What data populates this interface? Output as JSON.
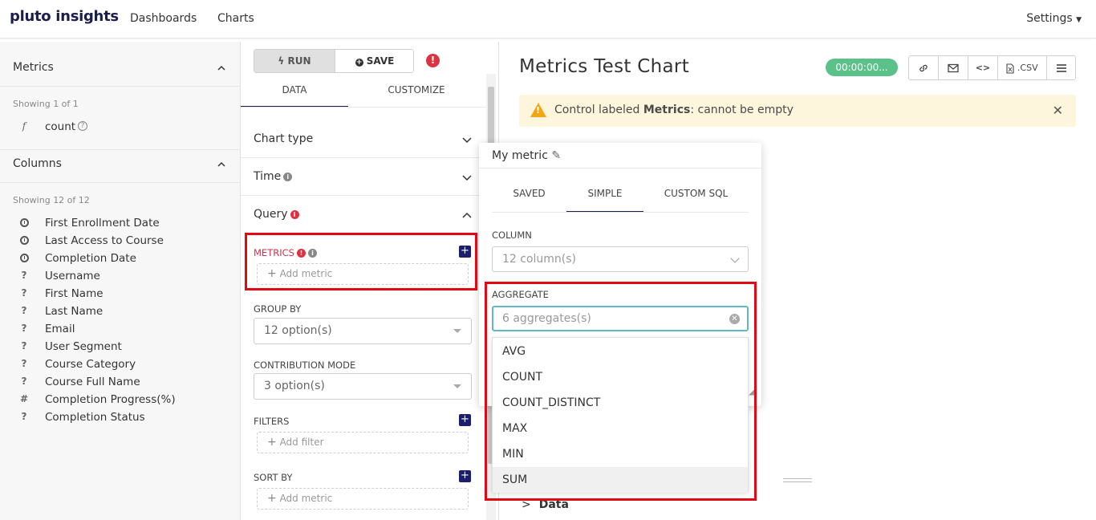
{
  "nav": {
    "logo": "pluto insights",
    "links": [
      "Dashboards",
      "Charts"
    ],
    "settings": "Settings"
  },
  "datasource": {
    "metrics_header": "Metrics",
    "metrics_showing": "Showing 1 of 1",
    "metrics": [
      {
        "type": "f",
        "label": "count"
      }
    ],
    "columns_header": "Columns",
    "columns_showing": "Showing 12 of 12",
    "columns": [
      {
        "type": "clock",
        "label": "First Enrollment Date"
      },
      {
        "type": "clock",
        "label": "Last Access to Course"
      },
      {
        "type": "clock",
        "label": "Completion Date"
      },
      {
        "type": "?",
        "label": "Username"
      },
      {
        "type": "?",
        "label": "First Name"
      },
      {
        "type": "?",
        "label": "Last Name"
      },
      {
        "type": "?",
        "label": "Email"
      },
      {
        "type": "?",
        "label": "User Segment"
      },
      {
        "type": "?",
        "label": "Course Category"
      },
      {
        "type": "?",
        "label": "Course Full Name"
      },
      {
        "type": "#",
        "label": "Completion Progress(%)"
      },
      {
        "type": "?",
        "label": "Completion Status"
      }
    ]
  },
  "controls": {
    "run_label": "RUN",
    "save_label": "SAVE",
    "tabs": [
      "DATA",
      "CUSTOMIZE"
    ],
    "chart_type": "Chart type",
    "time": "Time",
    "query": "Query",
    "metrics_label": "METRICS",
    "add_metric": "Add metric",
    "group_by_label": "GROUP BY",
    "group_by_value": "12 option(s)",
    "contribution_label": "CONTRIBUTION MODE",
    "contribution_value": "3 option(s)",
    "filters_label": "FILTERS",
    "add_filter": "Add filter",
    "sort_by_label": "SORT BY",
    "sort_add_metric": "Add metric"
  },
  "chart": {
    "title": "Metrics Test Chart",
    "timer": "00:00:00...",
    "csv_label": ".CSV",
    "alert_prefix": "Control labeled ",
    "alert_bold": "Metrics",
    "alert_suffix": ": cannot be empty",
    "data_section": "Data"
  },
  "popover": {
    "title": "My metric",
    "tabs": [
      "SAVED",
      "SIMPLE",
      "CUSTOM SQL"
    ],
    "column_label": "COLUMN",
    "column_placeholder": "12 column(s)",
    "aggregate_label": "AGGREGATE",
    "aggregate_placeholder": "6 aggregates(s)",
    "options": [
      "AVG",
      "COUNT",
      "COUNT_DISTINCT",
      "MAX",
      "MIN",
      "SUM"
    ]
  },
  "colors": {
    "brand": "#1b1e4b",
    "error": "#e03142",
    "timer": "#5ac189",
    "alert_bg": "#fdf6dd",
    "highlight": "#e10a14"
  }
}
